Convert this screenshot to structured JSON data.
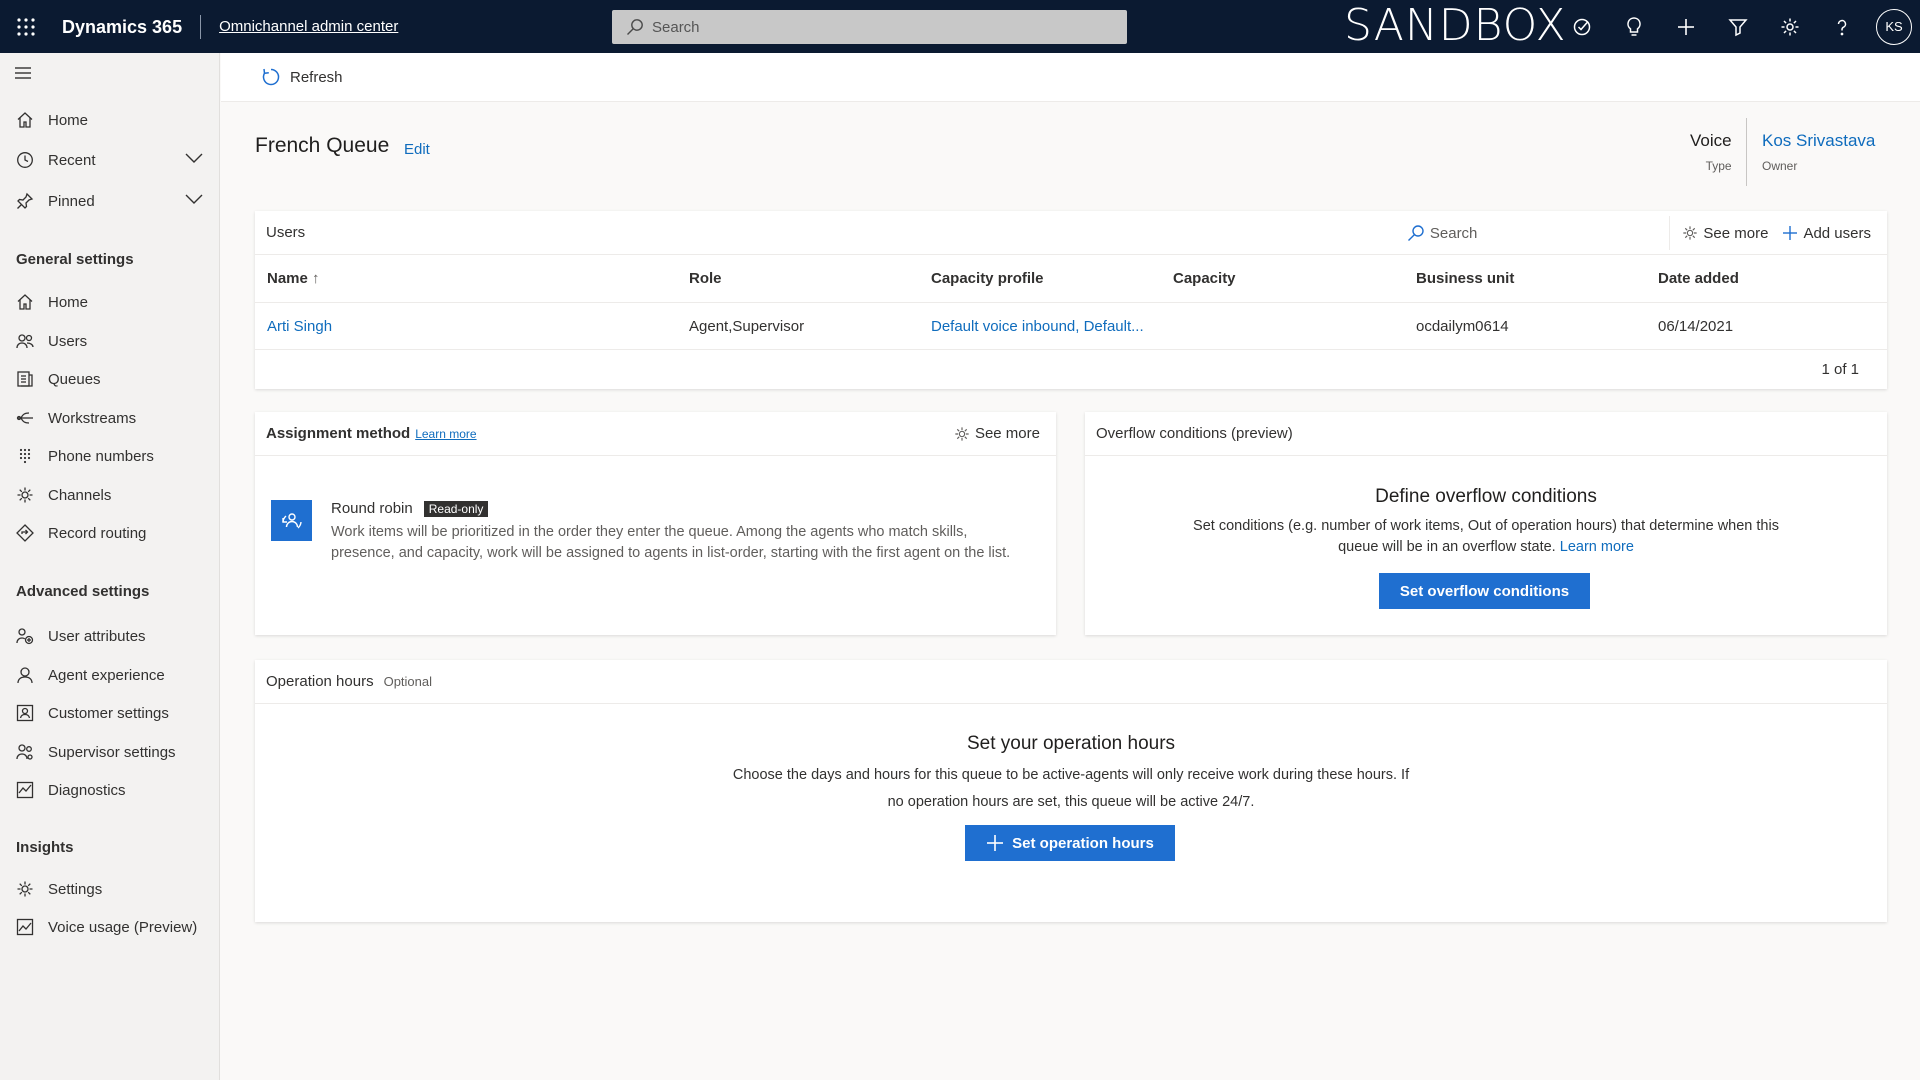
{
  "topbar": {
    "brand": "Dynamics 365",
    "app_name": "Omnichannel admin center",
    "search_placeholder": "Search",
    "environment_label": "SANDBOX",
    "avatar_initials": "KS",
    "icons": [
      "waffle-icon",
      "search-icon",
      "task-icon",
      "lightbulb-icon",
      "plus-icon",
      "filter-icon",
      "settings-icon",
      "help-icon"
    ]
  },
  "sidebar": {
    "top_items": [
      {
        "label": "Home",
        "icon": "home-icon"
      },
      {
        "label": "Recent",
        "icon": "clock-icon",
        "expandable": true
      },
      {
        "label": "Pinned",
        "icon": "pin-icon",
        "expandable": true
      }
    ],
    "general_header": "General settings",
    "general_items": [
      {
        "label": "Home",
        "icon": "home-icon"
      },
      {
        "label": "Users",
        "icon": "users-icon"
      },
      {
        "label": "Queues",
        "icon": "queues-icon"
      },
      {
        "label": "Workstreams",
        "icon": "workstreams-icon"
      },
      {
        "label": "Phone numbers",
        "icon": "dialpad-icon"
      },
      {
        "label": "Channels",
        "icon": "channels-icon"
      },
      {
        "label": "Record routing",
        "icon": "routing-icon"
      }
    ],
    "advanced_header": "Advanced settings",
    "advanced_items": [
      {
        "label": "User attributes",
        "icon": "user-attributes-icon"
      },
      {
        "label": "Agent experience",
        "icon": "agent-icon"
      },
      {
        "label": "Customer settings",
        "icon": "customer-icon"
      },
      {
        "label": "Supervisor settings",
        "icon": "supervisor-icon"
      },
      {
        "label": "Diagnostics",
        "icon": "diagnostics-icon"
      }
    ],
    "insights_header": "Insights",
    "insights_items": [
      {
        "label": "Settings",
        "icon": "settings-icon"
      },
      {
        "label": "Voice usage (Preview)",
        "icon": "chart-icon"
      }
    ]
  },
  "commandbar": {
    "refresh_label": "Refresh"
  },
  "header": {
    "title": "French Queue",
    "edit_label": "Edit",
    "type_value": "Voice",
    "type_label": "Type",
    "owner_value": "Kos Srivastava",
    "owner_label": "Owner"
  },
  "users": {
    "title": "Users",
    "search_label": "Search",
    "see_more_label": "See more",
    "add_users_label": "Add users",
    "columns": [
      "Name",
      "Role",
      "Capacity profile",
      "Capacity",
      "Business unit",
      "Date added"
    ],
    "sort_indicator": "↑",
    "rows": [
      {
        "name": "Arti Singh",
        "role": "Agent,Supervisor",
        "capacity_profile": "Default voice inbound, Default...",
        "capacity": "",
        "business_unit": "ocdailym0614",
        "date_added": "06/14/2021"
      }
    ],
    "pagination": "1 of 1"
  },
  "assignment": {
    "title": "Assignment method",
    "learn_more": "Learn more",
    "see_more_label": "See more",
    "method_name": "Round robin",
    "badge": "Read-only",
    "description": "Work items will be prioritized in the order they enter the queue. Among the agents who match skills, presence, and capacity, work will be assigned to agents in list-order, starting with the first agent on the list."
  },
  "overflow": {
    "title": "Overflow conditions (preview)",
    "heading": "Define overflow conditions",
    "text": "Set conditions (e.g. number of work items, Out of operation hours) that determine when this queue will be in an overflow state.",
    "learn_more": "Learn more",
    "button_label": "Set overflow conditions"
  },
  "operation_hours": {
    "title": "Operation hours",
    "optional_label": "Optional",
    "heading": "Set your operation hours",
    "text": "Choose the days and hours for this queue to be active-agents will only receive work during these hours. If no operation hours are set, this queue will be active 24/7.",
    "button_label": "Set operation hours"
  },
  "colors": {
    "topbar_bg": "#0b1a31",
    "accent": "#1f6fd0",
    "link": "#0f6cbd",
    "sidebar_bg": "#f3f2f1",
    "page_bg": "#faf9f8"
  }
}
